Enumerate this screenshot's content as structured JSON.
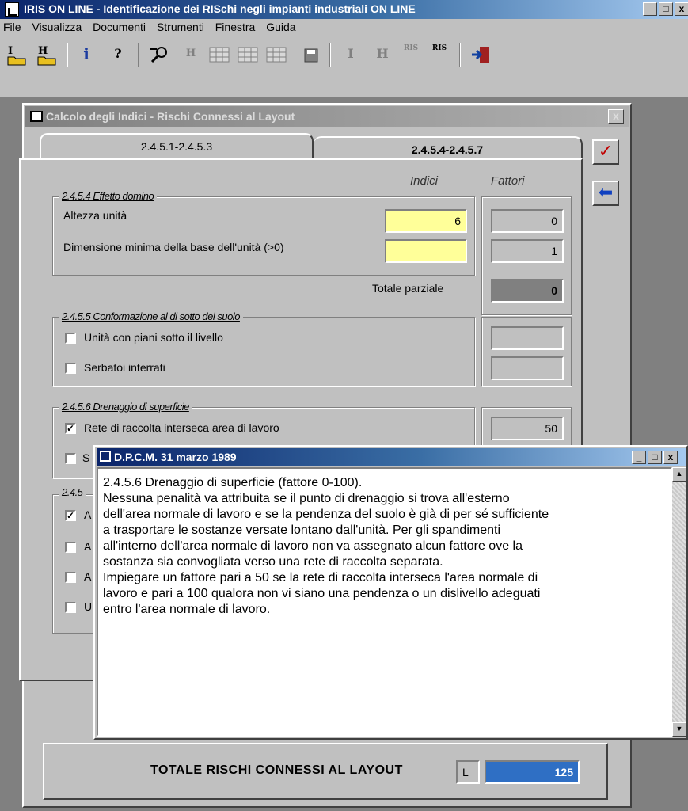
{
  "app": {
    "title": "IRIS ON LINE - Identificazione dei RISchi negli impianti industriali ON LINE",
    "min": "_",
    "max": "□",
    "close": "x"
  },
  "menu": [
    "File",
    "Visualizza",
    "Documenti",
    "Strumenti",
    "Finestra",
    "Guida"
  ],
  "toolbar": {
    "btn_i": "i",
    "btn_help": "?",
    "btn_h2": "H",
    "btn_ei": "I",
    "btn_eh": "H",
    "btn_ris1": "RIS",
    "btn_ris2": "RIS"
  },
  "child": {
    "title": "Calcolo degli Indici - Rischi Connessi al Layout",
    "close": "x"
  },
  "tabs": [
    {
      "label": "2.4.5.1-2.4.5.3"
    },
    {
      "label": "2.4.5.4-2.4.5.7"
    }
  ],
  "columns": {
    "indici": "Indici",
    "fattori": "Fattori"
  },
  "domino": {
    "header": "2.4.5.4 Effetto domino",
    "altezza_label": "Altezza unità",
    "altezza_value": "6",
    "altezza_fattore": "0",
    "dimensione_label": "Dimensione minima della base dell'unità (>0)",
    "dimensione_value": "",
    "dimensione_fattore": "1",
    "totale_label": "Totale parziale",
    "totale_value": "0"
  },
  "conformazione": {
    "header": "2.4.5.5 Conformazione al di sotto del suolo",
    "item1": "Unità con piani sotto il livello",
    "item2": "Serbatoi interrati"
  },
  "drenaggio": {
    "header": "2.4.5.6 Drenaggio di superficie",
    "item1": "Rete di raccolta interseca area di lavoro",
    "item1_fattore": "50",
    "item2_visible": "S"
  },
  "group4": {
    "header_visible": "2.4.5",
    "rows": [
      "A",
      "A",
      "A",
      "U"
    ]
  },
  "popup": {
    "title": "D.P.C.M. 31 marzo 1989",
    "text": "2.4.5.6 Drenaggio di superficie (fattore 0-100).\nNessuna penalità va attribuita se il punto di drenaggio si trova all'esterno\ndell'area normale di lavoro e se la pendenza del suolo è già di per sé sufficiente\na trasportare le sostanze versate lontano dall'unità. Per gli spandimenti\nall'interno dell'area normale di lavoro non va assegnato alcun fattore ove la\nsostanza sia convogliata verso una rete di raccolta separata.\nImpiegare un fattore pari a 50 se la rete di raccolta interseca l'area normale di\nlavoro e pari a 100 qualora non vi siano una pendenza o un dislivello adeguati\nentro l'area normale di lavoro."
  },
  "total": {
    "label": "TOTALE RISCHI CONNESSI AL LAYOUT",
    "code": "L",
    "value": "125"
  },
  "colors": {
    "accent": "#0a246a",
    "yellow_field": "#ffff99",
    "total_bar": "#2f6fc4"
  }
}
